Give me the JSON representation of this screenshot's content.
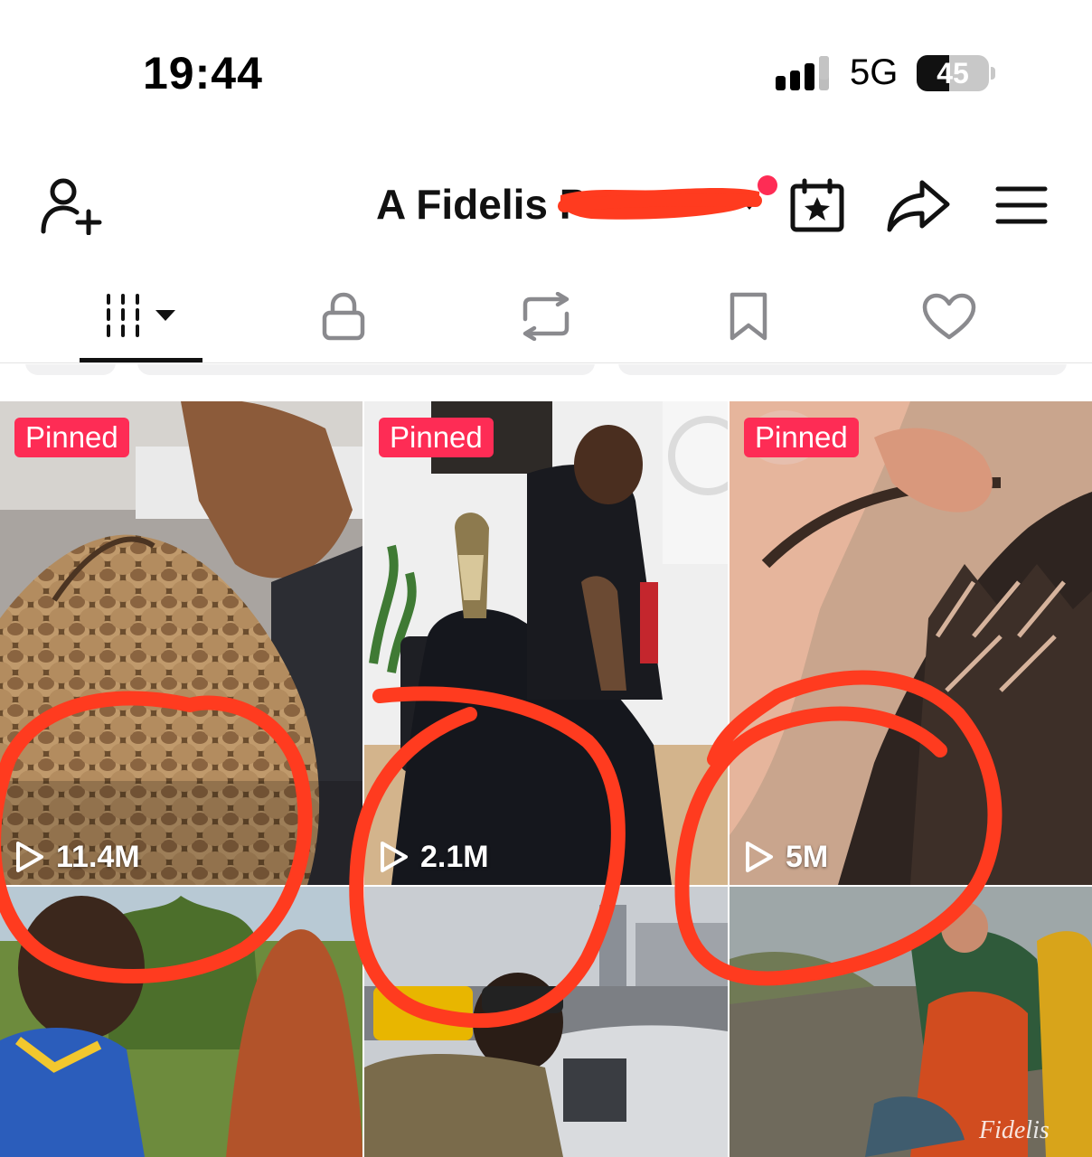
{
  "status_bar": {
    "time": "19:44",
    "network": "5G",
    "battery": "45",
    "battery_level": 0.45
  },
  "header": {
    "profile_name": "A Fidelis P",
    "icons": {
      "left": "add-user-icon",
      "calendar": "calendar-star-icon",
      "share": "share-arrow-icon",
      "menu": "hamburger-menu-icon"
    },
    "notification_dot_color": "#fe2c55"
  },
  "tabs": [
    {
      "name": "videos",
      "icon": "grid-icon",
      "active": true
    },
    {
      "name": "private",
      "icon": "lock-icon",
      "active": false
    },
    {
      "name": "reposts",
      "icon": "repost-icon",
      "active": false
    },
    {
      "name": "favorites",
      "icon": "bookmark-icon",
      "active": false
    },
    {
      "name": "liked",
      "icon": "heart-icon",
      "active": false
    }
  ],
  "videos": [
    {
      "pinned_label": "Pinned",
      "views": "11.4M"
    },
    {
      "pinned_label": "Pinned",
      "views": "2.1M"
    },
    {
      "pinned_label": "Pinned",
      "views": "5M"
    },
    {
      "pinned_label": "",
      "views": ""
    },
    {
      "pinned_label": "",
      "views": ""
    },
    {
      "pinned_label": "",
      "views": "",
      "watermark": "Fidelis"
    }
  ],
  "colors": {
    "accent": "#fe2c55",
    "annotation": "#ff3b1f",
    "text": "#111111"
  }
}
